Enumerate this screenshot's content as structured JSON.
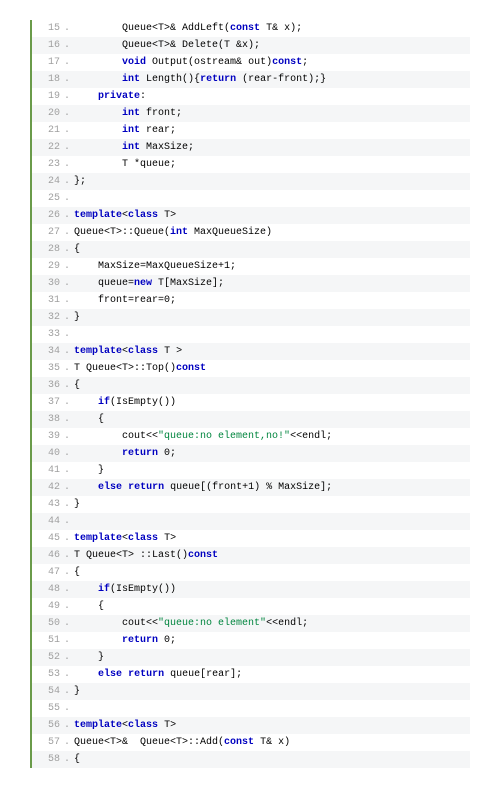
{
  "lines": [
    {
      "n": 15,
      "segs": [
        {
          "t": "        Queue<T>& AddLeft("
        },
        {
          "t": "const",
          "c": "kw"
        },
        {
          "t": " T& x);"
        }
      ]
    },
    {
      "n": 16,
      "segs": [
        {
          "t": "        Queue<T>& Delete(T &x);"
        }
      ]
    },
    {
      "n": 17,
      "segs": [
        {
          "t": "        "
        },
        {
          "t": "void",
          "c": "kw"
        },
        {
          "t": " Output(ostream& out)"
        },
        {
          "t": "const",
          "c": "kw"
        },
        {
          "t": ";"
        }
      ]
    },
    {
      "n": 18,
      "segs": [
        {
          "t": "        "
        },
        {
          "t": "int",
          "c": "kw"
        },
        {
          "t": " Length(){"
        },
        {
          "t": "return",
          "c": "kw"
        },
        {
          "t": " (rear-front);}"
        }
      ]
    },
    {
      "n": 19,
      "segs": [
        {
          "t": "    "
        },
        {
          "t": "private",
          "c": "kw"
        },
        {
          "t": ":"
        }
      ]
    },
    {
      "n": 20,
      "segs": [
        {
          "t": "        "
        },
        {
          "t": "int",
          "c": "kw"
        },
        {
          "t": " front;"
        }
      ]
    },
    {
      "n": 21,
      "segs": [
        {
          "t": "        "
        },
        {
          "t": "int",
          "c": "kw"
        },
        {
          "t": " rear;"
        }
      ]
    },
    {
      "n": 22,
      "segs": [
        {
          "t": "        "
        },
        {
          "t": "int",
          "c": "kw"
        },
        {
          "t": " MaxSize;"
        }
      ]
    },
    {
      "n": 23,
      "segs": [
        {
          "t": "        T *queue;"
        }
      ]
    },
    {
      "n": 24,
      "segs": [
        {
          "t": "};"
        }
      ]
    },
    {
      "n": 25,
      "segs": [
        {
          "t": ""
        }
      ]
    },
    {
      "n": 26,
      "segs": [
        {
          "t": "template",
          "c": "kw"
        },
        {
          "t": "<"
        },
        {
          "t": "class",
          "c": "kw"
        },
        {
          "t": " T>"
        }
      ]
    },
    {
      "n": 27,
      "segs": [
        {
          "t": "Queue<T>::Queue("
        },
        {
          "t": "int",
          "c": "kw"
        },
        {
          "t": " MaxQueueSize)"
        }
      ]
    },
    {
      "n": 28,
      "segs": [
        {
          "t": "{"
        }
      ]
    },
    {
      "n": 29,
      "segs": [
        {
          "t": "    MaxSize=MaxQueueSize+1;"
        }
      ]
    },
    {
      "n": 30,
      "segs": [
        {
          "t": "    queue="
        },
        {
          "t": "new",
          "c": "kw"
        },
        {
          "t": " T[MaxSize];"
        }
      ]
    },
    {
      "n": 31,
      "segs": [
        {
          "t": "    front=rear=0;"
        }
      ]
    },
    {
      "n": 32,
      "segs": [
        {
          "t": "}"
        }
      ]
    },
    {
      "n": 33,
      "segs": [
        {
          "t": ""
        }
      ]
    },
    {
      "n": 34,
      "segs": [
        {
          "t": "template",
          "c": "kw"
        },
        {
          "t": "<"
        },
        {
          "t": "class",
          "c": "kw"
        },
        {
          "t": " T >"
        }
      ]
    },
    {
      "n": 35,
      "segs": [
        {
          "t": "T Queue<T>::Top()"
        },
        {
          "t": "const",
          "c": "kw"
        }
      ]
    },
    {
      "n": 36,
      "segs": [
        {
          "t": "{"
        }
      ]
    },
    {
      "n": 37,
      "segs": [
        {
          "t": "    "
        },
        {
          "t": "if",
          "c": "kw"
        },
        {
          "t": "(IsEmpty())"
        }
      ]
    },
    {
      "n": 38,
      "segs": [
        {
          "t": "    {"
        }
      ]
    },
    {
      "n": 39,
      "segs": [
        {
          "t": "        cout<<"
        },
        {
          "t": "\"queue:no element,no!\"",
          "c": "str"
        },
        {
          "t": "<<endl;"
        }
      ]
    },
    {
      "n": 40,
      "segs": [
        {
          "t": "        "
        },
        {
          "t": "return",
          "c": "kw"
        },
        {
          "t": " 0;"
        }
      ]
    },
    {
      "n": 41,
      "segs": [
        {
          "t": "    }"
        }
      ]
    },
    {
      "n": 42,
      "segs": [
        {
          "t": "    "
        },
        {
          "t": "else",
          "c": "kw"
        },
        {
          "t": " "
        },
        {
          "t": "return",
          "c": "kw"
        },
        {
          "t": " queue[(front+1) % MaxSize];"
        }
      ]
    },
    {
      "n": 43,
      "segs": [
        {
          "t": "}"
        }
      ]
    },
    {
      "n": 44,
      "segs": [
        {
          "t": ""
        }
      ]
    },
    {
      "n": 45,
      "segs": [
        {
          "t": "template",
          "c": "kw"
        },
        {
          "t": "<"
        },
        {
          "t": "class",
          "c": "kw"
        },
        {
          "t": " T>"
        }
      ]
    },
    {
      "n": 46,
      "segs": [
        {
          "t": "T Queue<T> ::Last()"
        },
        {
          "t": "const",
          "c": "kw"
        }
      ]
    },
    {
      "n": 47,
      "segs": [
        {
          "t": "{"
        }
      ]
    },
    {
      "n": 48,
      "segs": [
        {
          "t": "    "
        },
        {
          "t": "if",
          "c": "kw"
        },
        {
          "t": "(IsEmpty())"
        }
      ]
    },
    {
      "n": 49,
      "segs": [
        {
          "t": "    {"
        }
      ]
    },
    {
      "n": 50,
      "segs": [
        {
          "t": "        cout<<"
        },
        {
          "t": "\"queue:no element\"",
          "c": "str"
        },
        {
          "t": "<<endl;"
        }
      ]
    },
    {
      "n": 51,
      "segs": [
        {
          "t": "        "
        },
        {
          "t": "return",
          "c": "kw"
        },
        {
          "t": " 0;"
        }
      ]
    },
    {
      "n": 52,
      "segs": [
        {
          "t": "    }"
        }
      ]
    },
    {
      "n": 53,
      "segs": [
        {
          "t": "    "
        },
        {
          "t": "else",
          "c": "kw"
        },
        {
          "t": " "
        },
        {
          "t": "return",
          "c": "kw"
        },
        {
          "t": " queue[rear];"
        }
      ]
    },
    {
      "n": 54,
      "segs": [
        {
          "t": "}"
        }
      ]
    },
    {
      "n": 55,
      "segs": [
        {
          "t": ""
        }
      ]
    },
    {
      "n": 56,
      "segs": [
        {
          "t": "template",
          "c": "kw"
        },
        {
          "t": "<"
        },
        {
          "t": "class",
          "c": "kw"
        },
        {
          "t": " T>"
        }
      ]
    },
    {
      "n": 57,
      "segs": [
        {
          "t": "Queue<T>&  Queue<T>::Add("
        },
        {
          "t": "const",
          "c": "kw"
        },
        {
          "t": " T& x)"
        }
      ]
    },
    {
      "n": 58,
      "segs": [
        {
          "t": "{"
        }
      ]
    }
  ]
}
